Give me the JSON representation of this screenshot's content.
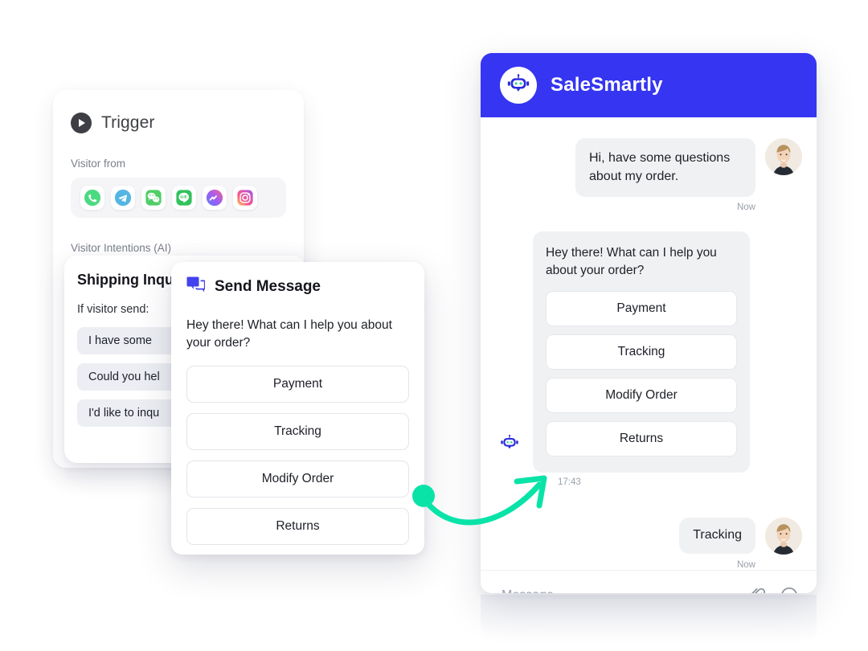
{
  "colors": {
    "brand_blue": "#3535F2",
    "accent_green": "#0ae3a8",
    "bubble_gray": "#F0F1F3",
    "chip_gray": "#ECEEF3",
    "text_dark": "#1D2027",
    "text_muted": "#9AA0AB"
  },
  "trigger_card": {
    "title": "Trigger",
    "play_icon": "play-circle-icon",
    "visitor_from_label": "Visitor from",
    "channels": [
      {
        "name": "whatsapp-icon",
        "label": "WhatsApp"
      },
      {
        "name": "telegram-icon",
        "label": "Telegram"
      },
      {
        "name": "wechat-icon",
        "label": "WeChat"
      },
      {
        "name": "line-icon",
        "label": "LINE"
      },
      {
        "name": "messenger-icon",
        "label": "Messenger"
      },
      {
        "name": "instagram-icon",
        "label": "Instagram"
      }
    ],
    "visitor_intentions_label": "Visitor Intentions (AI)"
  },
  "intent_card": {
    "title": "Shipping Inqu",
    "subtitle": "If visitor send:",
    "chips": [
      "I have some",
      "Could you hel",
      "I'd like to inqu"
    ]
  },
  "send_message_card": {
    "icon": "chat-bubbles-icon",
    "title": "Send Message",
    "body": "Hey there! What can I help you about your order?",
    "options": [
      "Payment",
      "Tracking",
      "Modify Order",
      "Returns"
    ]
  },
  "chat_widget": {
    "header": {
      "brand": "SaleSmartly",
      "logo_icon": "robot-avatar-icon"
    },
    "messages": [
      {
        "sender": "user",
        "text": "Hi, have some questions about my order.",
        "time": "Now",
        "avatar": "user-avatar"
      },
      {
        "sender": "bot",
        "text": "Hey there! What can I help you about your order?",
        "options": [
          "Payment",
          "Tracking",
          "Modify Order",
          "Returns"
        ],
        "time": "17:43",
        "avatar": "robot-avatar-icon"
      },
      {
        "sender": "user",
        "text": "Tracking",
        "time": "Now",
        "avatar": "user-avatar"
      }
    ],
    "footer": {
      "placeholder": "Message...",
      "attach_icon": "paperclip-icon",
      "emoji_icon": "smiley-face-icon"
    }
  },
  "connector": {
    "name": "flow-connector-arrow",
    "description": "curved green arrow from send-message card to chat bot reply"
  }
}
